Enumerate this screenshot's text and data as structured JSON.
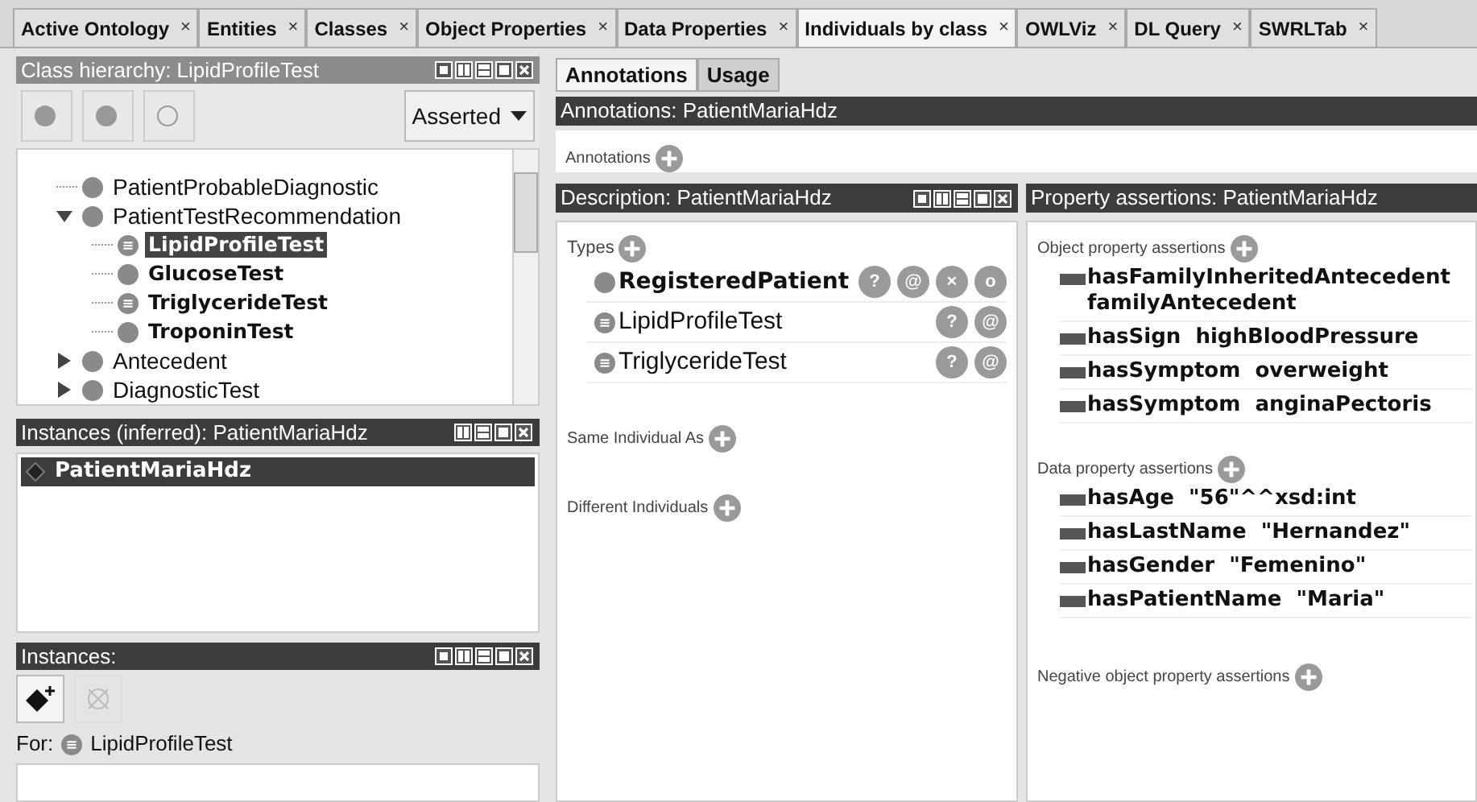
{
  "tabs": [
    {
      "label": "Active Ontology",
      "selected": false
    },
    {
      "label": "Entities",
      "selected": false
    },
    {
      "label": "Classes",
      "selected": false
    },
    {
      "label": "Object Properties",
      "selected": false
    },
    {
      "label": "Data Properties",
      "selected": false
    },
    {
      "label": "Individuals by class",
      "selected": true
    },
    {
      "label": "OWLViz",
      "selected": false
    },
    {
      "label": "DL Query",
      "selected": false
    },
    {
      "label": "SWRLTab",
      "selected": false
    }
  ],
  "tab_close": "×",
  "class_hierarchy": {
    "title": "Class hierarchy: LipidProfileTest",
    "mode": "Asserted",
    "tree": [
      {
        "label": "PatientProbableDiagnostic",
        "kind": "primitive",
        "bold": false,
        "selected": false
      },
      {
        "label": "PatientTestRecommendation",
        "kind": "primitive",
        "bold": false,
        "selected": false,
        "expanded": true,
        "children": [
          {
            "label": "LipidProfileTest",
            "kind": "defined",
            "bold": true,
            "selected": true
          },
          {
            "label": "GlucoseTest",
            "kind": "primitive",
            "bold": true,
            "selected": false
          },
          {
            "label": "TriglycerideTest",
            "kind": "defined",
            "bold": true,
            "selected": false
          },
          {
            "label": "TroponinTest",
            "kind": "primitive",
            "bold": true,
            "selected": false
          }
        ]
      },
      {
        "label": "Antecedent",
        "kind": "primitive",
        "bold": false,
        "selected": false,
        "expanded": false
      },
      {
        "label": "DiagnosticTest",
        "kind": "primitive",
        "bold": false,
        "selected": false,
        "expanded": false
      }
    ]
  },
  "instances_inferred": {
    "title": "Instances (inferred): PatientMariaHdz",
    "items": [
      {
        "label": "PatientMariaHdz",
        "selected": true
      }
    ]
  },
  "instances": {
    "title": "Instances:",
    "for_label": "For:",
    "for_class": "LipidProfileTest"
  },
  "right_tabs": [
    {
      "label": "Annotations",
      "selected": true
    },
    {
      "label": "Usage",
      "selected": false
    }
  ],
  "annotations": {
    "title": "Annotations: PatientMariaHdz",
    "section": "Annotations"
  },
  "description": {
    "title": "Description: PatientMariaHdz",
    "types_label": "Types",
    "types": [
      {
        "label": "RegisteredPatient",
        "kind": "primitive",
        "bold": true,
        "buttons": [
          "?",
          "@",
          "×",
          "o"
        ]
      },
      {
        "label": "LipidProfileTest",
        "kind": "defined",
        "bold": false,
        "buttons": [
          "?",
          "@"
        ]
      },
      {
        "label": "TriglycerideTest",
        "kind": "defined",
        "bold": false,
        "buttons": [
          "?",
          "@"
        ]
      }
    ],
    "sections": [
      "Same Individual As",
      "Different Individuals"
    ]
  },
  "property_assertions": {
    "title": "Property assertions: PatientMariaHdz",
    "object_label": "Object property assertions",
    "object": [
      {
        "property": "hasFamilyInheritedAntecedent",
        "value": "familyAntecedent"
      },
      {
        "property": "hasSign",
        "value": "highBloodPressure"
      },
      {
        "property": "hasSymptom",
        "value": "overweight"
      },
      {
        "property": "hasSymptom",
        "value": "anginaPectoris"
      }
    ],
    "data_label": "Data property assertions",
    "data": [
      {
        "property": "hasAge",
        "value": "\"56\"^^xsd:int"
      },
      {
        "property": "hasLastName",
        "value": "\"Hernandez\""
      },
      {
        "property": "hasGender",
        "value": "\"Femenino\""
      },
      {
        "property": "hasPatientName",
        "value": "\"Maria\""
      }
    ],
    "negative_label": "Negative object property assertions"
  }
}
